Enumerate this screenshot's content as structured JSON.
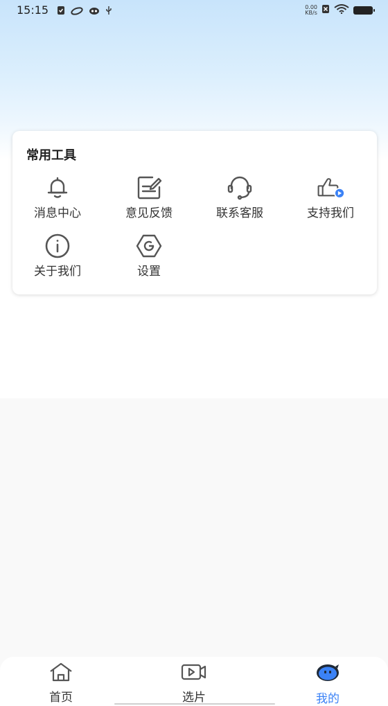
{
  "status_bar": {
    "time": "15:15",
    "net_speed_value": "0.00",
    "net_speed_unit": "KB/s"
  },
  "tools": {
    "title": "常用工具",
    "items": [
      {
        "label": "消息中心",
        "icon": "bell-icon"
      },
      {
        "label": "意见反馈",
        "icon": "feedback-edit-icon"
      },
      {
        "label": "联系客服",
        "icon": "headset-icon"
      },
      {
        "label": "支持我们",
        "icon": "thumbs-up-play-icon"
      },
      {
        "label": "关于我们",
        "icon": "info-icon"
      },
      {
        "label": "设置",
        "icon": "gear-icon"
      }
    ]
  },
  "bottom_nav": {
    "items": [
      {
        "label": "首页",
        "icon": "home-icon",
        "active": false
      },
      {
        "label": "选片",
        "icon": "video-play-icon",
        "active": false
      },
      {
        "label": "我的",
        "icon": "mascot-avatar-icon",
        "active": true
      }
    ]
  },
  "colors": {
    "accent": "#3b82f6",
    "icon_gray": "#555555",
    "background_gradient_top": "#c8e4fb"
  }
}
